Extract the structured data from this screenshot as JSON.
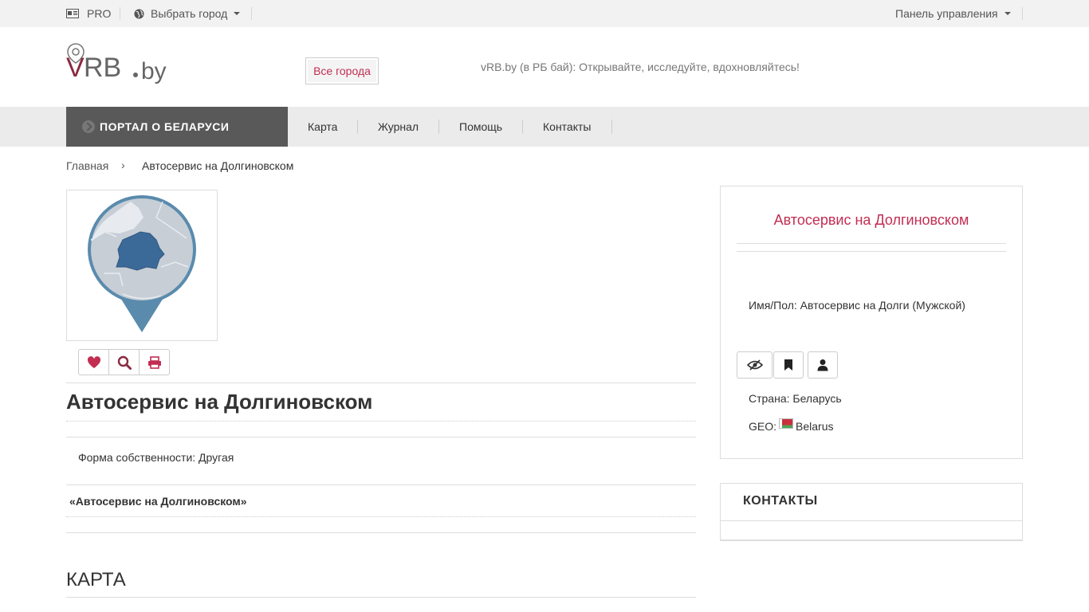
{
  "topbar": {
    "pro_label": "PRO",
    "city_label": "Выбрать город",
    "panel_label": "Панель управления"
  },
  "header": {
    "all_cities": "Все города",
    "slogan": "vRB.by (в РБ бай): Открывайте, исследуйте, вдохновляйтесь!"
  },
  "nav": {
    "portal": "ПОРТАЛ О БЕЛАРУСИ",
    "items": [
      "Карта",
      "Журнал",
      "Помощь",
      "Контакты"
    ]
  },
  "breadcrumb": {
    "home": "Главная",
    "separator": "›",
    "current": "Автосервис на Долгиновском"
  },
  "main": {
    "title": "Автосервис на Долгиновском",
    "ownership": "Форма собственности: Другая",
    "quoted_name": "«Автосервис на Долгиновском»",
    "map_title": "КАРТА"
  },
  "sidebar": {
    "title": "Автосервис на Долгиновском",
    "name_gender": "Имя/Пол: Автосервис на Долги (Мужской)",
    "country": "Страна: Беларусь",
    "geo_label": "GEO:",
    "geo_value": "Belarus",
    "contacts_title": "КОНТАКТЫ"
  },
  "colors": {
    "accent": "#c22e52",
    "portal_bg": "#595959",
    "navbar_bg": "#ebebeb",
    "map_blue": "#3b6a99"
  }
}
